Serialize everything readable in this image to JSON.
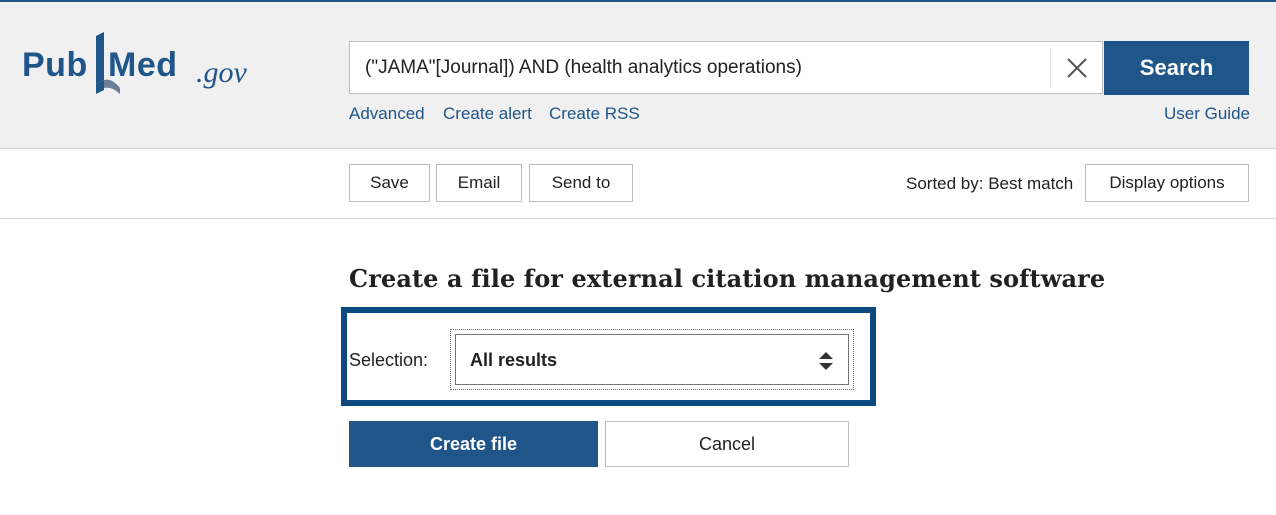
{
  "brand": {
    "logo_pub": "Pub",
    "logo_med": "Med",
    "logo_gov": ".gov",
    "color": "#20558a"
  },
  "search": {
    "query": "(\"JAMA\"[Journal]) AND (health analytics operations)",
    "clear_icon": "close-icon",
    "button_label": "Search"
  },
  "header_links": {
    "advanced": "Advanced",
    "create_alert": "Create alert",
    "create_rss": "Create RSS",
    "user_guide": "User Guide"
  },
  "toolbar": {
    "save": "Save",
    "email": "Email",
    "send_to": "Send to",
    "sorted_by": "Sorted by: Best match",
    "display_options": "Display options"
  },
  "citation_panel": {
    "heading": "Create a file for external citation management software",
    "selection_label": "Selection:",
    "selection_value": "All results",
    "selection_icon": "sort-arrows-icon",
    "create_file": "Create file",
    "cancel": "Cancel",
    "focus_color": "#0b4a7e"
  }
}
